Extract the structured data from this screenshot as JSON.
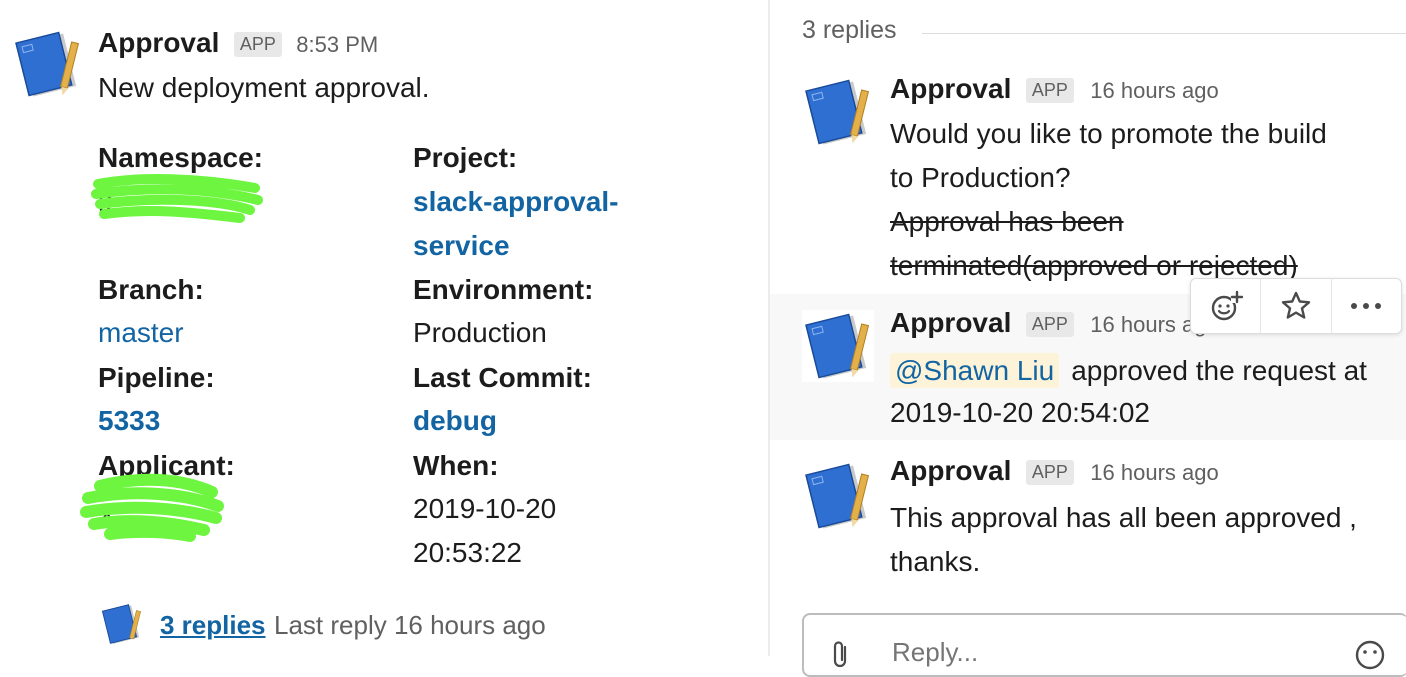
{
  "main_message": {
    "sender": "Approval",
    "badge": "APP",
    "time": "8:53 PM",
    "text": "New deployment approval.",
    "fields": {
      "namespace": {
        "label": "Namespace:",
        "value": "k..."
      },
      "project": {
        "label": "Project:",
        "value_line1": "slack-approval-",
        "value_line2": "service"
      },
      "branch": {
        "label": "Branch:",
        "value": "master"
      },
      "environment": {
        "label": "Environment:",
        "value": "Production"
      },
      "pipeline": {
        "label": "Pipeline:",
        "value": "5333"
      },
      "last_commit": {
        "label": "Last Commit:",
        "value": "debug"
      },
      "applicant": {
        "label": "Applicant:",
        "value": "x"
      },
      "when": {
        "label": "When:",
        "value_line1": "2019-10-20",
        "value_line2": "20:53:22"
      }
    },
    "thread": {
      "link": "3 replies",
      "last_reply": "Last reply 16 hours ago"
    }
  },
  "thread_pane": {
    "replies_count": "3 replies",
    "replies": [
      {
        "sender": "Approval",
        "badge": "APP",
        "time": "16 hours ago",
        "line1": "Would you like to promote the build",
        "line2": "to Production?",
        "strike_line1": "Approval has been",
        "strike_line2": "terminated(approved or rejected)"
      },
      {
        "sender": "Approval",
        "badge": "APP",
        "time": "16 hours ago",
        "mention": "@Shawn Liu",
        "text": "approved the request at",
        "line2": "2019-10-20 20:54:02"
      },
      {
        "sender": "Approval",
        "badge": "APP",
        "time": "16 hours ago",
        "line1": "This approval has all been approved ,",
        "line2": "thanks."
      }
    ],
    "reply_placeholder": "Reply..."
  },
  "icons": {
    "avatar": "notebook-pencil-icon",
    "toolbar": [
      "add-reaction-icon",
      "star-icon",
      "more-actions-icon"
    ],
    "composer": [
      "paperclip-icon",
      "emoji-icon"
    ]
  },
  "colors": {
    "link": "#1264a3",
    "redaction": "#6df53f",
    "mention_bg": "#fcf3d9",
    "hover_bg": "#f8f8f8"
  }
}
